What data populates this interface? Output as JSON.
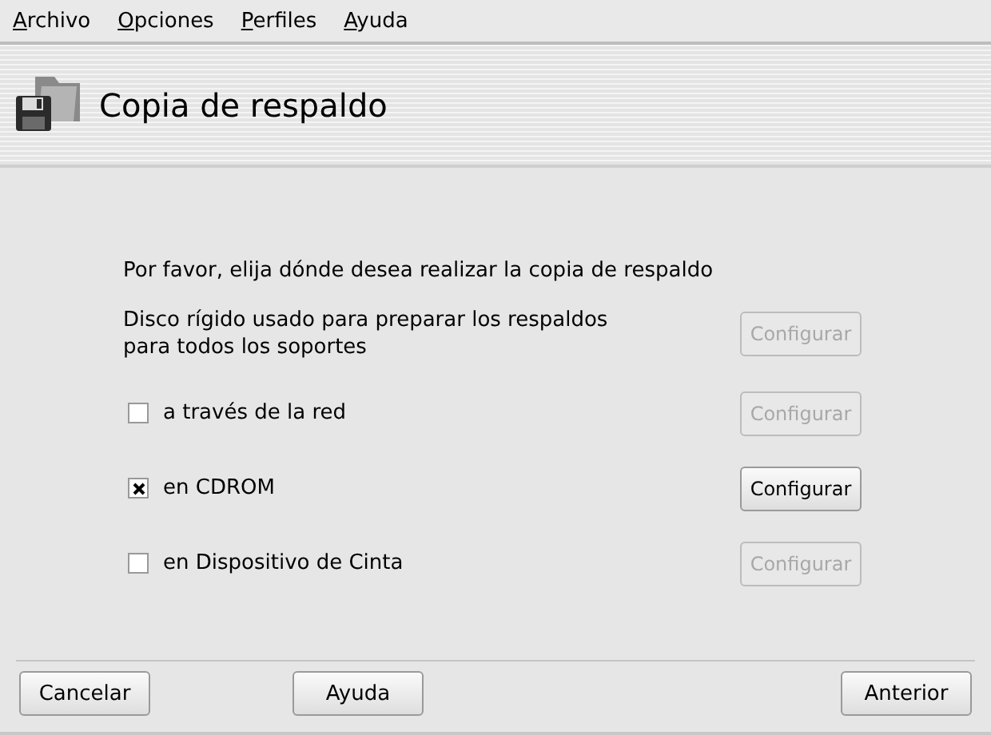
{
  "menu": [
    {
      "label": "Archivo"
    },
    {
      "label": "Opciones"
    },
    {
      "label": "Perfiles"
    },
    {
      "label": "Ayuda"
    }
  ],
  "header": {
    "title": "Copia de respaldo"
  },
  "prompt": "Por favor, elija dónde desea realizar la copia de respaldo",
  "options": [
    {
      "kind": "plain",
      "label": "Disco rígido usado para preparar los respaldos\npara todos los soportes",
      "button": "Configurar",
      "button_disabled": true
    },
    {
      "kind": "checkbox",
      "label": "a través de la red",
      "checked": false,
      "button": "Configurar",
      "button_disabled": true
    },
    {
      "kind": "checkbox",
      "label": "en CDROM",
      "checked": true,
      "button": "Configurar",
      "button_disabled": false
    },
    {
      "kind": "checkbox",
      "label": "en Dispositivo de Cinta",
      "checked": false,
      "button": "Configurar",
      "button_disabled": true
    }
  ],
  "footer": {
    "left": "Cancelar",
    "middle": "Ayuda",
    "right": "Anterior"
  }
}
